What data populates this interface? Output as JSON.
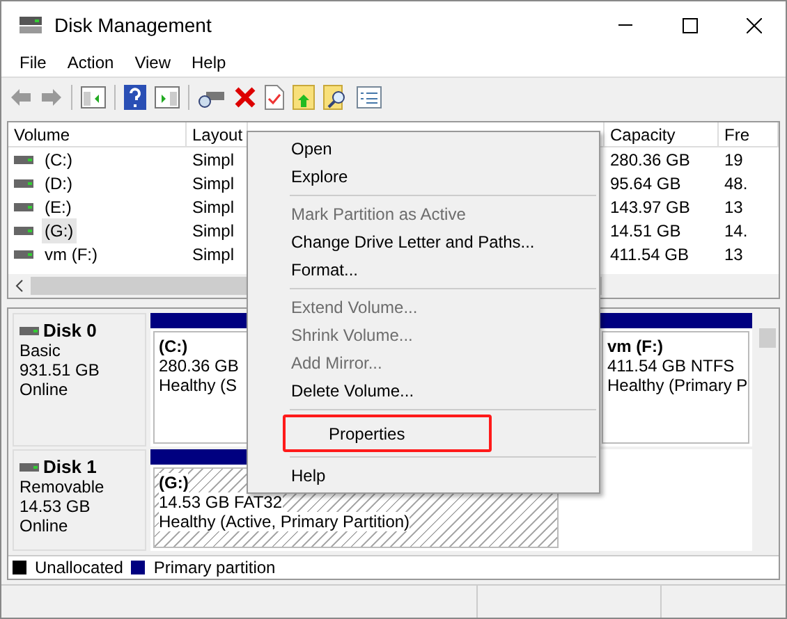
{
  "window": {
    "title": "Disk Management"
  },
  "menu_bar": [
    "File",
    "Action",
    "View",
    "Help"
  ],
  "table": {
    "columns": [
      "Volume",
      "Layout",
      "Capacity",
      "Fre"
    ],
    "rows": [
      {
        "volume": "(C:)",
        "layout": "Simpl",
        "capacity": "280.36 GB",
        "free": "19",
        "selected": false
      },
      {
        "volume": "(D:)",
        "layout": "Simpl",
        "capacity": "95.64 GB",
        "free": "48.",
        "selected": false
      },
      {
        "volume": "(E:)",
        "layout": "Simpl",
        "capacity": "143.97 GB",
        "free": "13",
        "selected": false
      },
      {
        "volume": "(G:)",
        "layout": "Simpl",
        "capacity": "14.51 GB",
        "free": "14.",
        "selected": true
      },
      {
        "volume": "vm (F:)",
        "layout": "Simpl",
        "capacity": "411.54 GB",
        "free": "13",
        "selected": false
      }
    ]
  },
  "disks": [
    {
      "name": "Disk 0",
      "type": "Basic",
      "size": "931.51 GB",
      "state": "Online",
      "partitions": [
        {
          "name": "(C:)",
          "size": "280.36 GB",
          "status": "Healthy (S",
          "hatched": false
        },
        {
          "name": "vm  (F:)",
          "size": "411.54 GB NTFS",
          "status": "Healthy (Primary P",
          "hatched": false
        }
      ]
    },
    {
      "name": "Disk 1",
      "type": "Removable",
      "size": "14.53 GB",
      "state": "Online",
      "partitions": [
        {
          "name": "(G:)",
          "size": "14.53 GB FAT32",
          "status": "Healthy (Active, Primary Partition)",
          "hatched": true
        }
      ]
    }
  ],
  "legend": [
    {
      "label": "Unallocated",
      "color": "#000000"
    },
    {
      "label": "Primary partition",
      "color": "#000080"
    }
  ],
  "context_menu": [
    {
      "kind": "item",
      "label": "Open",
      "disabled": false,
      "highlighted": false
    },
    {
      "kind": "item",
      "label": "Explore",
      "disabled": false,
      "highlighted": false
    },
    {
      "kind": "separator"
    },
    {
      "kind": "item",
      "label": "Mark Partition as Active",
      "disabled": true,
      "highlighted": false
    },
    {
      "kind": "item",
      "label": "Change Drive Letter and Paths...",
      "disabled": false,
      "highlighted": false
    },
    {
      "kind": "item",
      "label": "Format...",
      "disabled": false,
      "highlighted": false
    },
    {
      "kind": "separator"
    },
    {
      "kind": "item",
      "label": "Extend Volume...",
      "disabled": true,
      "highlighted": false
    },
    {
      "kind": "item",
      "label": "Shrink Volume...",
      "disabled": true,
      "highlighted": false
    },
    {
      "kind": "item",
      "label": "Add Mirror...",
      "disabled": true,
      "highlighted": false
    },
    {
      "kind": "item",
      "label": "Delete Volume...",
      "disabled": false,
      "highlighted": false
    },
    {
      "kind": "separator"
    },
    {
      "kind": "item",
      "label": "Properties",
      "disabled": false,
      "highlighted": true
    },
    {
      "kind": "separator"
    },
    {
      "kind": "item",
      "label": "Help",
      "disabled": false,
      "highlighted": false
    }
  ]
}
